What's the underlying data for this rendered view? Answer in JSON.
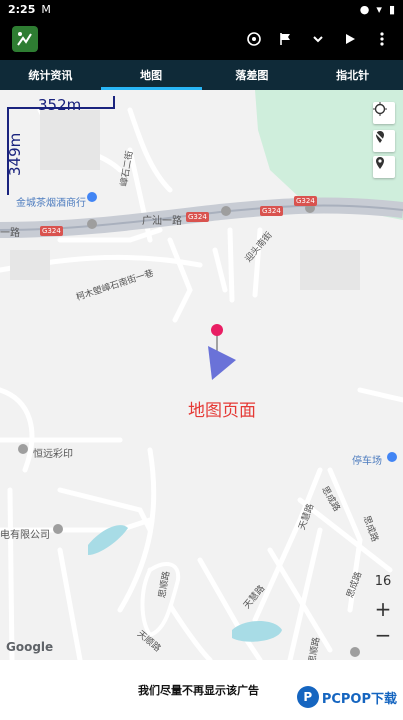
{
  "status_bar": {
    "time": "2:25",
    "mail_icon": "M",
    "wifi": "▾",
    "battery": "▮"
  },
  "app_bar": {
    "logo_icon": "map-chart-icon"
  },
  "tabs": [
    {
      "label": "统计资讯"
    },
    {
      "label": "地图"
    },
    {
      "label": "落差图"
    },
    {
      "label": "指北针"
    }
  ],
  "active_tab": "地图",
  "scale": {
    "horizontal": "352m",
    "vertical": "349m"
  },
  "map": {
    "labels": {
      "hotel": "金城茶烟酒商行",
      "road1": "广汕一路",
      "road2": "广汕一路",
      "road3": "柯木塱嶂石南街一巷",
      "road4": "嶂石二街",
      "road5": "迎头南街",
      "print_shop": "恒远彩印",
      "company": "电有限公司",
      "parking": "停车场",
      "road6": "思成路",
      "road7": "天慧路",
      "road8": "思成路",
      "road9": "天慧路",
      "road10": "思顺路",
      "road11": "思成路",
      "road12": "天顺路",
      "road13": "思顺路",
      "road_left": "一路"
    },
    "road_badges": [
      "G324",
      "G324",
      "G324",
      "G324"
    ],
    "page_label": "地图页面",
    "zoom_level": "16",
    "zoom_in": "+",
    "zoom_out": "−",
    "attribution": "Google"
  },
  "ad": {
    "text": "我们尽量不再显示该广告"
  },
  "watermark": {
    "circle": "P",
    "text": "PCPOP下载"
  }
}
